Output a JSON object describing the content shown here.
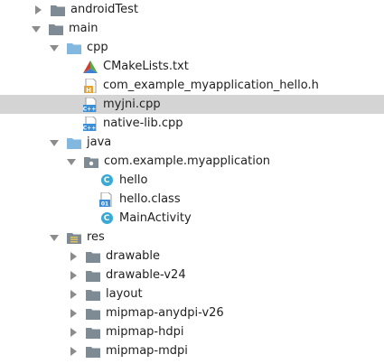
{
  "colors": {
    "folder_gray": "#7e8b95",
    "folder_blue": "#82b7e0",
    "selection": "#d4d4d4",
    "cpp_blue": "#3c8fd7",
    "h_orange": "#e3a33a",
    "cmake_red": "#d83c2d",
    "cmake_blue": "#3a7fd4",
    "cmake_green": "#5aaa4b"
  },
  "tree": {
    "androidTest": "androidTest",
    "main": "main",
    "cpp": "cpp",
    "cmakelists": "CMakeLists.txt",
    "hello_h": "com_example_myapplication_hello.h",
    "myjni_cpp": "myjni.cpp",
    "nativelib_cpp": "native-lib.cpp",
    "java": "java",
    "package": "com.example.myapplication",
    "hello": "hello",
    "hello_class": "hello.class",
    "mainactivity": "MainActivity",
    "res": "res",
    "drawable": "drawable",
    "drawable_v24": "drawable-v24",
    "layout": "layout",
    "mipmap_anydpi": "mipmap-anydpi-v26",
    "mipmap_hdpi": "mipmap-hdpi",
    "mipmap_mdpi": "mipmap-mdpi"
  },
  "icons": {
    "collapsed": "chevron-right-icon",
    "expanded": "chevron-down-icon",
    "folder": "folder-icon",
    "cmake": "cmake-icon",
    "header": "header-file-icon",
    "cpp": "cpp-file-icon",
    "class": "class-icon",
    "compiled_class": "compiled-class-icon"
  }
}
